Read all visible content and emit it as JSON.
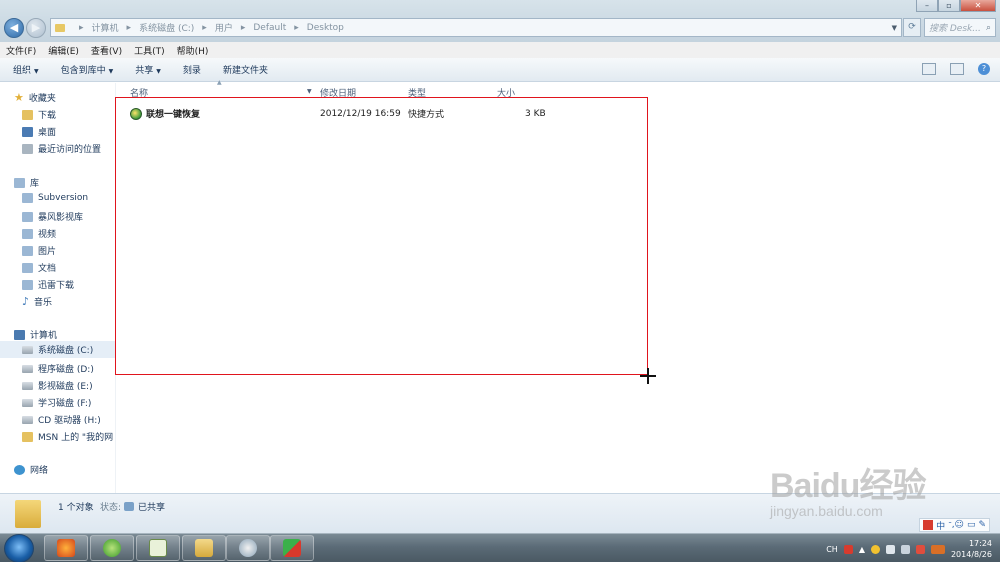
{
  "window": {
    "controls": [
      "–",
      "▫",
      "✕"
    ]
  },
  "address": {
    "segments": [
      "计算机",
      "系统磁盘 (C:)",
      "用户",
      "Default",
      "Desktop"
    ],
    "separator": "▸"
  },
  "search": {
    "placeholder": "搜索 Desk...",
    "icon": "search-icon"
  },
  "menu": [
    "文件(F)",
    "编辑(E)",
    "查看(V)",
    "工具(T)",
    "帮助(H)"
  ],
  "toolbar": {
    "organize": "组织",
    "include": "包含到库中",
    "share": "共享",
    "burn": "刻录",
    "newfolder": "新建文件夹"
  },
  "sidebar": {
    "favorites": {
      "label": "收藏夹",
      "items": [
        "下载",
        "桌面",
        "最近访问的位置"
      ]
    },
    "libraries": {
      "label": "库",
      "items": [
        "Subversion",
        "暴风影视库",
        "视频",
        "图片",
        "文档",
        "迅雷下载",
        "音乐"
      ]
    },
    "computer": {
      "label": "计算机",
      "items": [
        "系统磁盘 (C:)",
        "程序磁盘 (D:)",
        "影视磁盘 (E:)",
        "学习磁盘 (F:)",
        "CD 驱动器 (H:)",
        "MSN 上的 \"我的网"
      ]
    },
    "network": {
      "label": "网络"
    }
  },
  "columns": {
    "name": "名称",
    "date": "修改日期",
    "type": "类型",
    "size": "大小"
  },
  "files": [
    {
      "name": "联想一键恢复",
      "date": "2012/12/19 16:59",
      "type": "快捷方式",
      "size": "3 KB"
    }
  ],
  "details": {
    "count": "1 个对象",
    "state_label": "状态:",
    "state": "已共享"
  },
  "taskbar": {
    "lang": "CH",
    "time": "17:24",
    "date": "2014/8/26"
  },
  "ime": {
    "label": "中",
    "extra": "ᐨ,☺"
  },
  "watermark": {
    "brand": "Baidu经验",
    "url": "jingyan.baidu.com"
  },
  "colors": {
    "selection_rect": "#e0141d",
    "accent": "#1e395b"
  }
}
